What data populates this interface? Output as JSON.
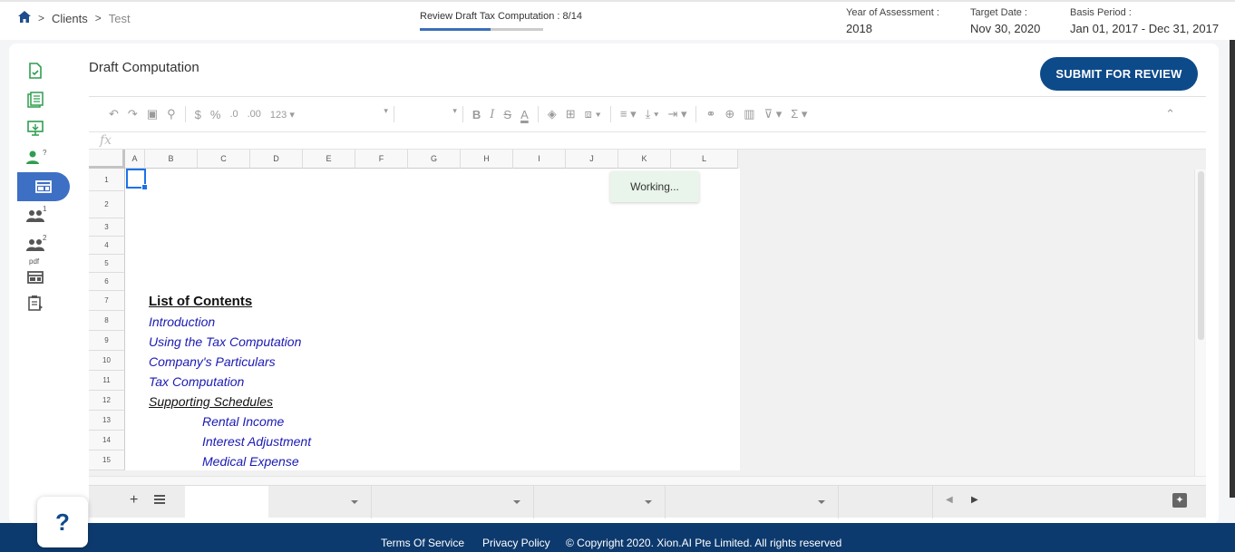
{
  "breadcrumb": {
    "level1": "Clients",
    "level2": "Test"
  },
  "progress": {
    "label": "Review Draft Tax Computation : 8/14",
    "step": 8,
    "total": 14
  },
  "meta": {
    "year_label": "Year of Assessment :",
    "year_value": "2018",
    "target_label": "Target Date :",
    "target_value": "Nov 30, 2020",
    "basis_label": "Basis Period :",
    "basis_value": "Jan 01, 2017 - Dec 31, 2017"
  },
  "page": {
    "title": "Draft Computation",
    "submit_label": "SUBMIT FOR REVIEW"
  },
  "sidebar": {
    "items": [
      {
        "icon": "document-check-icon"
      },
      {
        "icon": "document-list-icon"
      },
      {
        "icon": "monitor-upload-icon"
      },
      {
        "icon": "person-question-icon",
        "sup": "?"
      },
      {
        "icon": "table-view-icon",
        "active": true
      },
      {
        "icon": "group-icon",
        "sup": "1"
      },
      {
        "icon": "group-icon",
        "sup": "2"
      },
      {
        "icon": "pdf-table-icon",
        "sup": "pdf"
      },
      {
        "icon": "clipboard-play-icon"
      }
    ]
  },
  "toolbar": {
    "currency": "$",
    "percent": "%",
    "dec_less": ".0",
    "dec_more": ".00",
    "format_123": "123"
  },
  "sheet": {
    "fx": "fx",
    "columns": [
      "A",
      "B",
      "C",
      "D",
      "E",
      "F",
      "G",
      "H",
      "I",
      "J",
      "K",
      "L"
    ],
    "rows": [
      {
        "num": "1",
        "text": ""
      },
      {
        "num": "2",
        "text": ""
      },
      {
        "num": "3",
        "text": ""
      },
      {
        "num": "4",
        "text": ""
      },
      {
        "num": "5",
        "text": ""
      },
      {
        "num": "6",
        "text": ""
      },
      {
        "num": "7",
        "text": "List of Contents"
      },
      {
        "num": "8",
        "text": "Introduction"
      },
      {
        "num": "9",
        "text": "Using the Tax Computation"
      },
      {
        "num": "10",
        "text": "Company's Particulars"
      },
      {
        "num": "11",
        "text": "Tax Computation"
      },
      {
        "num": "12",
        "text": "Supporting Schedules"
      },
      {
        "num": "13",
        "text": "Rental Income"
      },
      {
        "num": "14",
        "text": "Interest Adjustment"
      },
      {
        "num": "15",
        "text": "Medical Expense"
      }
    ],
    "working": "Working...",
    "add_sheet": "+"
  },
  "help": {
    "label": "?"
  },
  "footer": {
    "terms": "Terms Of Service",
    "privacy": "Privacy Policy",
    "copyright": "© Copyright 2020. Xion.AI Pte Limited. All rights reserved"
  },
  "colors": {
    "primary": "#0d4a8a",
    "active_nav": "#3d70c4",
    "footer": "#0d3a6e",
    "link_text": "#1a1ab4",
    "nav_green": "#2e9e4f"
  }
}
